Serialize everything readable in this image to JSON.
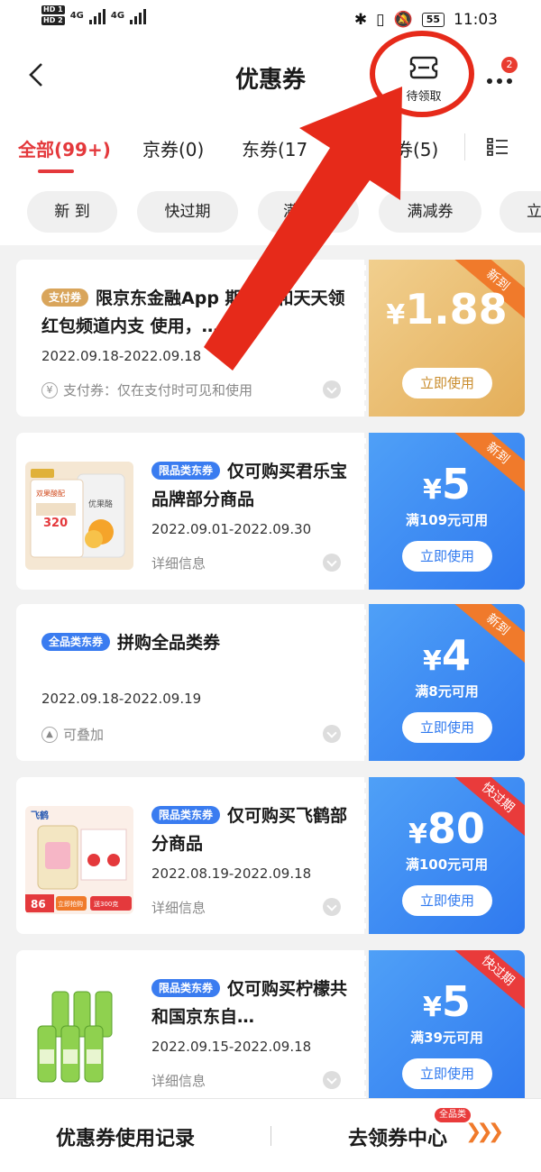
{
  "status_bar": {
    "hd1": "HD 1",
    "hd2": "HD 2",
    "net1": "4G",
    "net2": "4G",
    "battery": "55",
    "time": "11:03"
  },
  "header": {
    "title": "优惠券",
    "pending_label": "待领取",
    "notification_count": "2"
  },
  "tabs": [
    {
      "label": "全部(99+)",
      "active": true
    },
    {
      "label": "京券(0)"
    },
    {
      "label": "东券(17"
    },
    {
      "label": "费券(5)"
    }
  ],
  "filters": [
    "新 到",
    "快过期",
    "满",
    "满减券",
    "立"
  ],
  "coupons": [
    {
      "tag": "支付券",
      "title": "限京东金融App 期商城和天天领红包频道内支 使用，…",
      "date": "2022.09.18-2022.09.18",
      "detail": "支付券：仅在支付时可见和使用",
      "yen": "¥",
      "amount": "1.88",
      "condition": "",
      "button": "立即使用",
      "corner": "新到"
    },
    {
      "tag": "限品类东券",
      "title": "仅可购买君乐宝品牌部分商品",
      "date": "2022.09.01-2022.09.30",
      "detail": "详细信息",
      "yen": "¥",
      "amount": "5",
      "condition": "满109元可用",
      "button": "立即使用",
      "corner": "新到"
    },
    {
      "tag": "全品类东券",
      "title": "拼购全品类券",
      "date": "2022.09.18-2022.09.19",
      "detail": "可叠加",
      "yen": "¥",
      "amount": "4",
      "condition": "满8元可用",
      "button": "立即使用",
      "corner": "新到"
    },
    {
      "tag": "限品类东券",
      "title": "仅可购买飞鹤部分商品",
      "date": "2022.08.19-2022.09.18",
      "detail": "详细信息",
      "yen": "¥",
      "amount": "80",
      "condition": "满100元可用",
      "button": "立即使用",
      "corner": "快过期"
    },
    {
      "tag": "限品类东券",
      "title": "仅可购买柠檬共和国京东自…",
      "date": "2022.09.15-2022.09.18",
      "detail": "详细信息",
      "yen": "¥",
      "amount": "5",
      "condition": "满39元可用",
      "button": "立即使用",
      "corner": "快过期"
    }
  ],
  "thumbs": {
    "junlebao_badge": "双果酸配",
    "junlebao_price": "320",
    "junlebao_bag": "优果酪",
    "feihe_brand": "飞鹤",
    "feihe_price": "86",
    "feihe_buy": "立即抢购",
    "feihe_gift": "送300克"
  },
  "bottom": {
    "records": "优惠券使用记录",
    "center": "去领券中心",
    "center_badge": "全品类",
    "arrows": "❯❯❯"
  },
  "colors": {
    "accent": "#e4393c",
    "gold": "#e4ae59",
    "blue": "#2f79ef",
    "new_corner": "#f07a2b",
    "exp_corner": "#e93b3b"
  }
}
